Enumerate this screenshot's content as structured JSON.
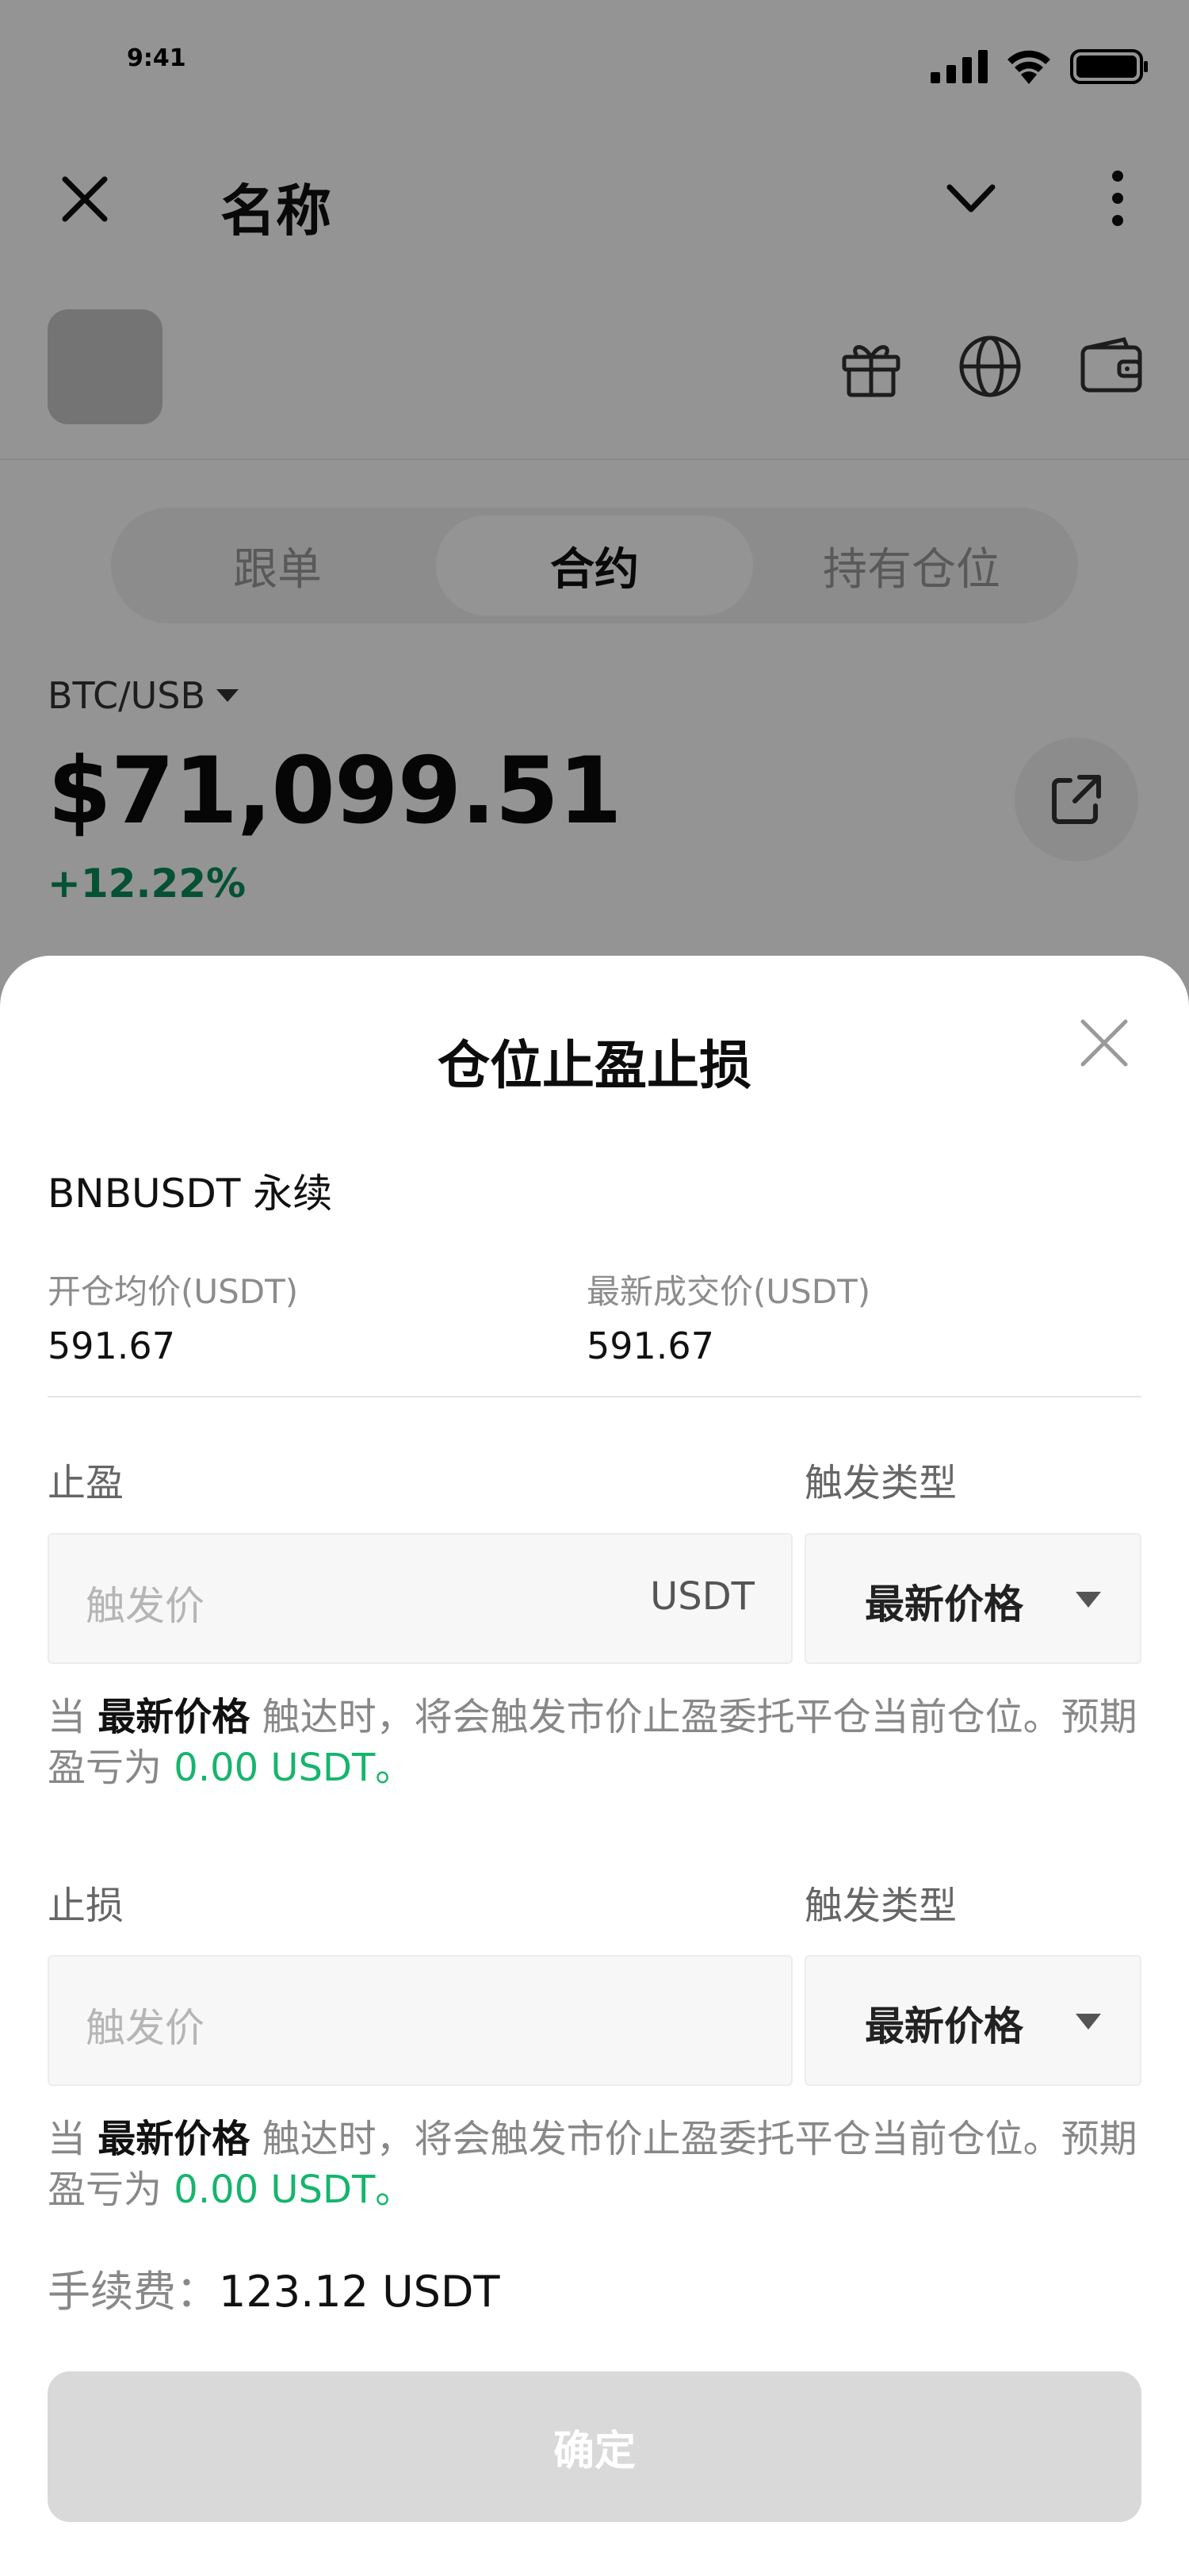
{
  "status_bar": {
    "time": "9:41"
  },
  "header": {
    "title": "名称"
  },
  "segments": [
    {
      "label": "跟单",
      "active": false
    },
    {
      "label": "合约",
      "active": true
    },
    {
      "label": "持有仓位",
      "active": false
    }
  ],
  "market": {
    "pair": "BTC/USB",
    "price": "$71,099.51",
    "change": "+12.22%",
    "change_color": "#0a8c5a"
  },
  "icons": {
    "close": "close-icon",
    "dropdown": "chevron-down-icon",
    "more": "more-vertical-icon",
    "gift": "gift-icon",
    "globe": "globe-icon",
    "wallet": "wallet-icon",
    "share": "share-icon",
    "pair_caret": "caret-down-icon"
  },
  "sheet": {
    "title": "仓位止盈止损",
    "contract": "BNBUSDT 永续",
    "entry_price_label": "开仓均价(USDT)",
    "entry_price": "591.67",
    "last_price_label": "最新成交价(USDT)",
    "last_price": "591.67",
    "take_profit": {
      "label": "止盈",
      "trigger_type_label": "触发类型",
      "placeholder": "触发价",
      "unit": "USDT",
      "trigger_type": "最新价格",
      "hint_prefix": "当",
      "hint_bold": "最新价格",
      "hint_middle": "触达时，将会触发市价止盈委托平仓当前仓位。预期盈亏为",
      "hint_value": "0.00 USDT。"
    },
    "stop_loss": {
      "label": "止损",
      "trigger_type_label": "触发类型",
      "placeholder": "触发价",
      "trigger_type": "最新价格",
      "hint_prefix": "当",
      "hint_bold": "最新价格",
      "hint_middle": "触达时，将会触发市价止盈委托平仓当前仓位。预期盈亏为",
      "hint_value": "0.00 USDT。"
    },
    "fee_label": "手续费：",
    "fee_value": "123.12 USDT",
    "confirm_label": "确定"
  },
  "colors": {
    "positive": "#17b46d",
    "overlay": "rgba(0,0,0,0.42)",
    "button_disabled": "#d9d9d9"
  }
}
